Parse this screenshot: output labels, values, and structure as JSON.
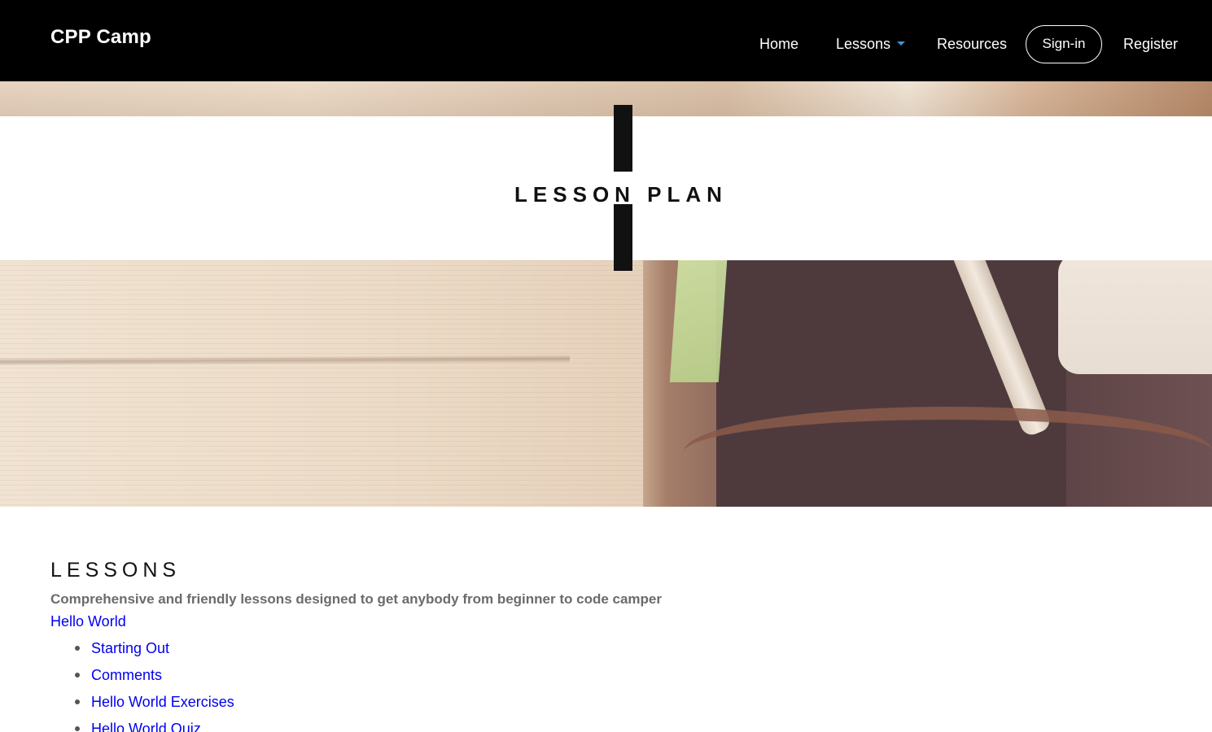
{
  "site": {
    "brand": "CPP Camp"
  },
  "nav": {
    "home": "Home",
    "lessons": "Lessons",
    "resources": "Resources",
    "signin": "Sign-in",
    "register": "Register",
    "caret_color": "#3f95d6"
  },
  "hero": {
    "title": "LESSON PLAN"
  },
  "lessons_section": {
    "heading": "LESSONS",
    "subtitle": "Comprehensive and friendly lessons designed to get anybody from beginner to code camper",
    "group": "Hello World",
    "items": [
      "Starting Out",
      "Comments",
      "Hello World Exercises",
      "Hello World Quiz"
    ]
  },
  "colors": {
    "navbar_bg": "#000000",
    "link": "#0000ee",
    "subtitle": "#6b6b6b"
  }
}
